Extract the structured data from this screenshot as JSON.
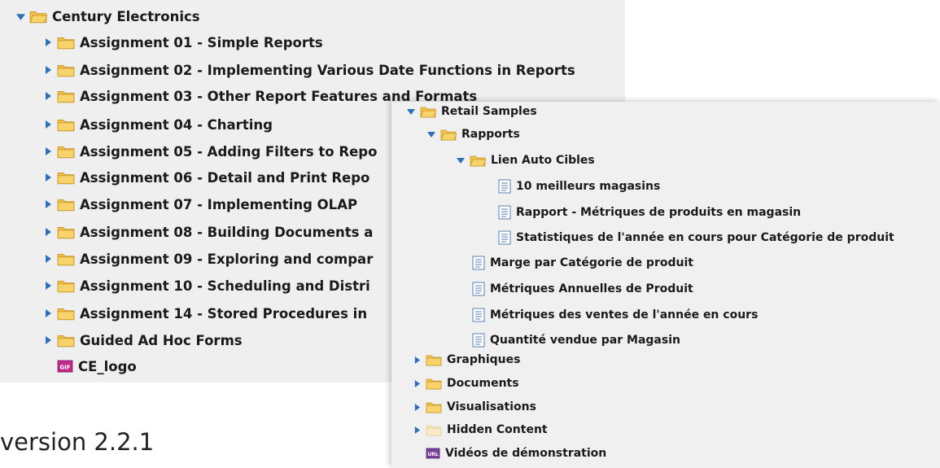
{
  "tree1": {
    "root_label": "Century Electronics",
    "children": [
      "Assignment 01 - Simple Reports",
      "Assignment 02 - Implementing Various Date Functions in Reports",
      "Assignment 03 - Other Report Features and Formats",
      "Assignment 04 - Charting",
      "Assignment 05 - Adding Filters to Repo",
      "Assignment 06 - Detail and Print Repo",
      "Assignment 07 - Implementing OLAP",
      "Assignment 08 - Building Documents a",
      "Assignment 09 - Exploring and compar",
      "Assignment 10 - Scheduling and Distri",
      "Assignment 14 - Stored Procedures in",
      "Guided Ad Hoc Forms"
    ],
    "file_label": "CE_logo",
    "file_badge": "GIF"
  },
  "tree2": {
    "root_label": "Retail Samples",
    "rapports_label": "Rapports",
    "lien_label": "Lien Auto Cibles",
    "lien_items": [
      "10 meilleurs magasins",
      "Rapport - Métriques de produits en magasin",
      "Statistiques de l'année en cours pour Catégorie de produit"
    ],
    "rapport_items": [
      "Marge par Catégorie de produit",
      "Métriques Annuelles de Produit",
      "Métriques des ventes de l'année en cours",
      "Quantité vendue par Magasin"
    ],
    "folders": [
      "Graphiques",
      "Documents",
      "Visualisations",
      "Hidden Content"
    ],
    "url_label": "Vidéos de démonstration",
    "url_badge": "URL"
  },
  "version_text": "version 2.2.1",
  "colors": {
    "folder": "#f2c14e",
    "arrow": "#2f6fb5",
    "panel": "#efefef"
  }
}
